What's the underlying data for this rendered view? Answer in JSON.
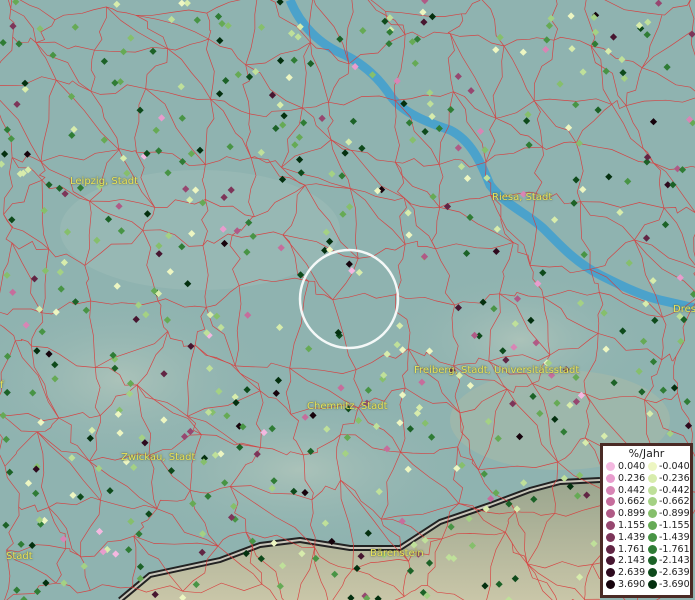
{
  "places": [
    {
      "id": "leipzig",
      "label": "Leipzig, Stadt"
    },
    {
      "id": "riesa",
      "label": "Riesa, Stadt"
    },
    {
      "id": "dresden",
      "label": "Dres"
    },
    {
      "id": "freiberg",
      "label": "Freiberg, Stadt, Universitätsstadt"
    },
    {
      "id": "chemnitz",
      "label": "Chemnitz, Stadt"
    },
    {
      "id": "zwickau",
      "label": "Zwickau, Stadt"
    },
    {
      "id": "baerenstein",
      "label": "Bärenstein"
    },
    {
      "id": "left-edge-stadt",
      "label": "Stadt"
    },
    {
      "id": "left-edge-f",
      "label": "f"
    }
  ],
  "legend": {
    "title": "%/Jahr",
    "rows": [
      {
        "pos": "0.040",
        "neg": "-0.040",
        "pos_color": "#f4b8e0",
        "neg_color": "#edf6c2"
      },
      {
        "pos": "0.236",
        "neg": "-0.236",
        "pos_color": "#e89ccd",
        "neg_color": "#d7ecac"
      },
      {
        "pos": "0.442",
        "neg": "-0.442",
        "pos_color": "#d885b5",
        "neg_color": "#bfe09a"
      },
      {
        "pos": "0.662",
        "neg": "-0.662",
        "pos_color": "#c66d9c",
        "neg_color": "#a4d184"
      },
      {
        "pos": "0.899",
        "neg": "-0.899",
        "pos_color": "#b05a86",
        "neg_color": "#86bf6c"
      },
      {
        "pos": "1.155",
        "neg": "-1.155",
        "pos_color": "#974770",
        "neg_color": "#66aa55"
      },
      {
        "pos": "1.439",
        "neg": "-1.439",
        "pos_color": "#7d3559",
        "neg_color": "#489445"
      },
      {
        "pos": "1.761",
        "neg": "-1.761",
        "pos_color": "#622544",
        "neg_color": "#2f7c35"
      },
      {
        "pos": "2.143",
        "neg": "-2.143",
        "pos_color": "#471630",
        "neg_color": "#1c6227"
      },
      {
        "pos": "2.639",
        "neg": "-2.639",
        "pos_color": "#2e0a1e",
        "neg_color": "#0e4a1b"
      },
      {
        "pos": "3.690",
        "neg": "-3.690",
        "pos_color": "#16030c",
        "neg_color": "#04300f"
      }
    ]
  },
  "colors": {
    "boundary": "#d93a3a",
    "river": "#3f9fd0",
    "terrain": "#8fb3b0",
    "highlight_circle": "#ffffff"
  }
}
